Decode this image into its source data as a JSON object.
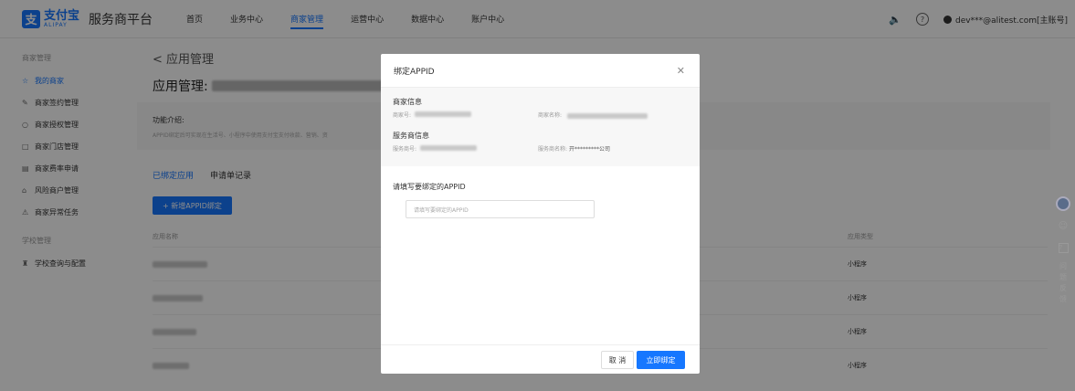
{
  "topbar": {
    "logo_cn": "支付宝",
    "logo_en": "ALIPAY",
    "platform_name": "服务商平台",
    "nav": [
      "首页",
      "业务中心",
      "商家管理",
      "运营中心",
      "数据中心",
      "账户中心"
    ],
    "account": "dev***@alitest.com[主账号]"
  },
  "sidebar": {
    "group1": "商家管理",
    "items": [
      {
        "label": "我的商家",
        "icon": "user-group-icon"
      },
      {
        "label": "商家签约管理",
        "icon": "contract-icon"
      },
      {
        "label": "商家授权管理",
        "icon": "shield-icon"
      },
      {
        "label": "商家门店管理",
        "icon": "store-icon"
      },
      {
        "label": "商家费率申请",
        "icon": "rate-icon"
      },
      {
        "label": "风险商户管理",
        "icon": "home-icon"
      },
      {
        "label": "商家异常任务",
        "icon": "alert-icon"
      }
    ],
    "group2": "学校管理",
    "school_item": {
      "label": "学校查询与配置",
      "icon": "school-icon"
    }
  },
  "main": {
    "back": "< 应用管理",
    "title_prefix": "应用管理:",
    "intro_title": "功能介绍:",
    "intro_text": "APPID绑定后可实现在生活号、小程序中使用支付宝支付收款、营销、资",
    "tabs": [
      "已绑定应用",
      "申请单记录"
    ],
    "add_button": "+ 新增APPID绑定",
    "table": {
      "col_name": "应用名称",
      "col_type": "应用类型",
      "rows": [
        {
          "type": "小程序"
        },
        {
          "type": "小程序"
        },
        {
          "type": "小程序"
        },
        {
          "type": "小程序"
        }
      ]
    }
  },
  "float_tools": {
    "feedback": [
      "问",
      "题",
      "反",
      "馈"
    ]
  },
  "modal": {
    "title": "绑定APPID",
    "merchant_section": "商家信息",
    "merchant_no_label": "商家号:",
    "merchant_name_label": "商家名称:",
    "provider_section": "服务商信息",
    "provider_no_label": "服务商号:",
    "provider_name_label": "服务商名称:",
    "provider_name_value": "开*********公司",
    "form_label": "请填写要绑定的APPID",
    "input_placeholder": "请填写要绑定的APPID",
    "cancel": "取 消",
    "confirm": "立即绑定"
  }
}
